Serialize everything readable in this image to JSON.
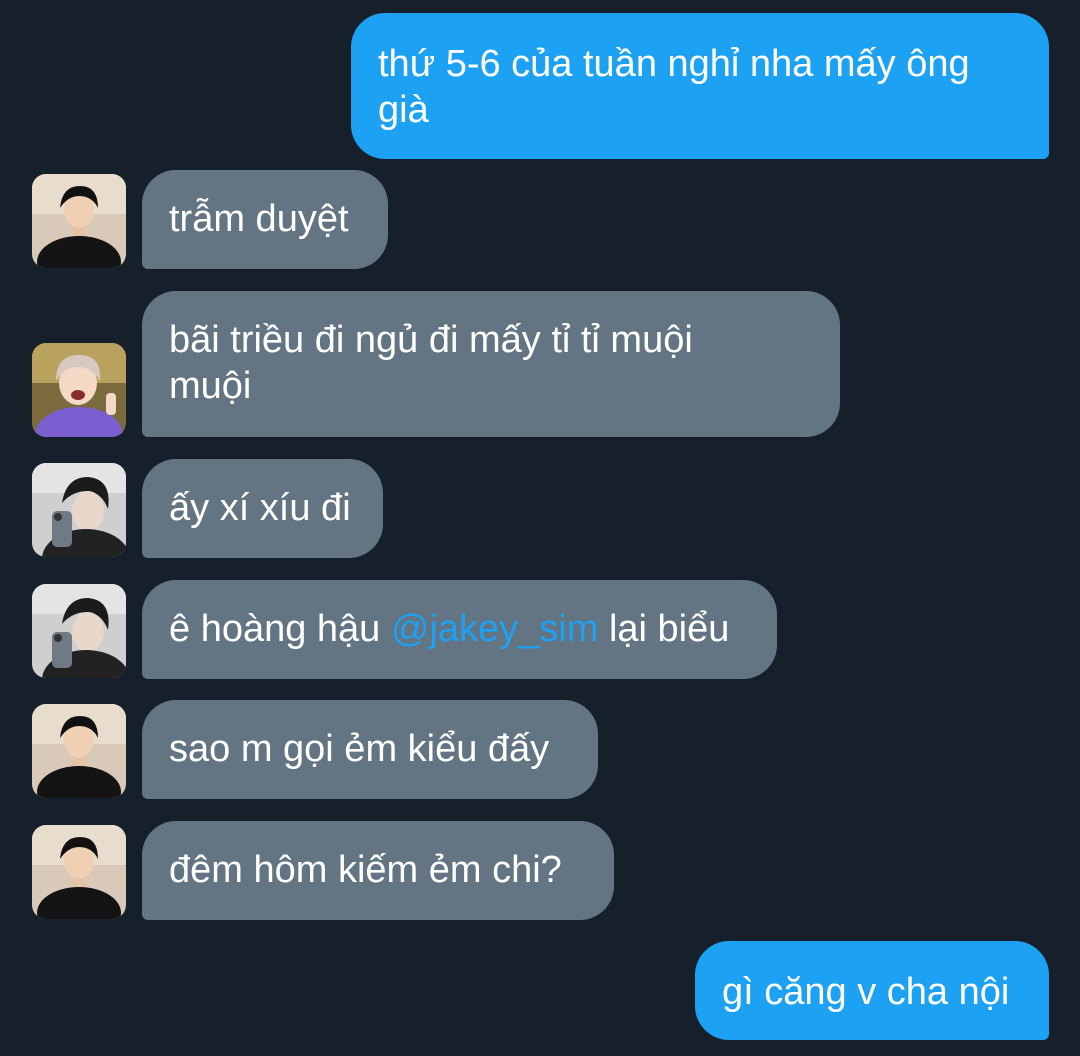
{
  "messages": [
    {
      "type": "sent",
      "text": "thứ 5-6 của tuần nghỉ nha mấy ông\ngià"
    },
    {
      "type": "received",
      "avatar": "avatar-dark-shirt-man",
      "text": "trẫm duyệt"
    },
    {
      "type": "received",
      "avatar": "avatar-smiling-purple-shirt",
      "text": "bãi triều đi ngủ đi mấy tỉ tỉ muội\nmuội"
    },
    {
      "type": "received",
      "avatar": "avatar-mirror-selfie",
      "text": "ấy xí xíu đi"
    },
    {
      "type": "received",
      "avatar": "avatar-mirror-selfie",
      "text_before": "ê hoàng hậu ",
      "mention": "@jakey_sim",
      "text_after": " lại biểu"
    },
    {
      "type": "received",
      "avatar": "avatar-dark-shirt-man",
      "text": "sao m gọi ẻm kiểu đấy"
    },
    {
      "type": "received",
      "avatar": "avatar-dark-shirt-man",
      "text": "đêm hôm kiếm ẻm chi?"
    },
    {
      "type": "sent",
      "text": "gì căng v cha nội"
    }
  ],
  "colors": {
    "background": "#16202b",
    "sent_bubble": "#1da1f2",
    "received_bubble": "#637482",
    "mention": "#1da1f2",
    "text": "#ffffff"
  }
}
